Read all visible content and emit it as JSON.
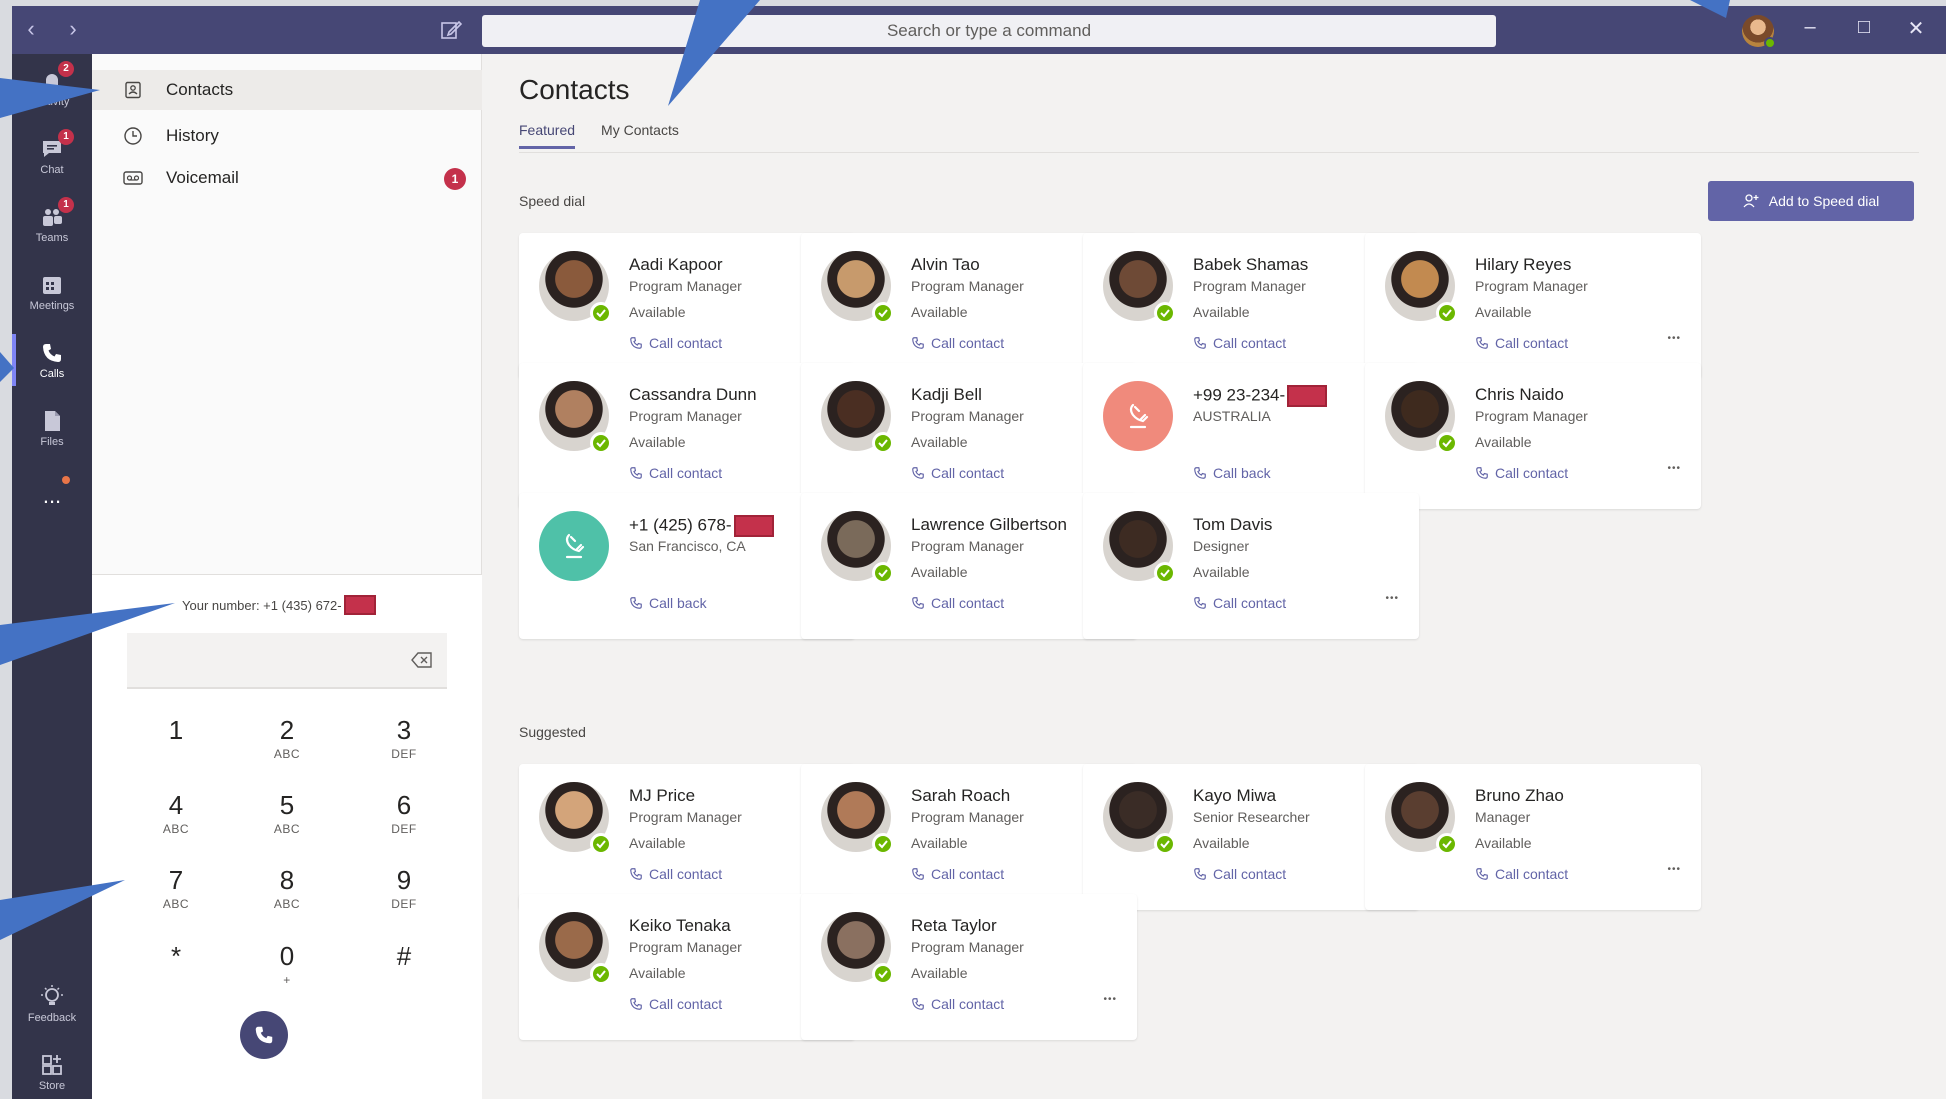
{
  "window": {
    "search_placeholder": "Search or type a command",
    "back_icon": "chevron-left-icon",
    "forward_icon": "chevron-right-icon"
  },
  "appbar": {
    "items": [
      {
        "label": "Activity",
        "icon": "bell-icon",
        "badge": "2"
      },
      {
        "label": "Chat",
        "icon": "chat-icon",
        "badge": "1"
      },
      {
        "label": "Teams",
        "icon": "teams-icon",
        "badge": "1"
      },
      {
        "label": "Meetings",
        "icon": "calendar-icon"
      },
      {
        "label": "Calls",
        "icon": "phone-icon",
        "active": true
      },
      {
        "label": "Files",
        "icon": "file-icon"
      },
      {
        "label": "...",
        "icon": "more-icon"
      },
      {
        "label": "Feedback",
        "icon": "lightbulb-icon"
      },
      {
        "label": "Store",
        "icon": "store-icon"
      }
    ]
  },
  "leftpane": {
    "items": [
      {
        "label": "Contacts",
        "icon": "contacts-icon",
        "active": true
      },
      {
        "label": "History",
        "icon": "clock-icon"
      },
      {
        "label": "Voicemail",
        "icon": "voicemail-icon",
        "badge": "1"
      }
    ],
    "your_number": "Your number: +1 (435) 672-",
    "dialpad": [
      {
        "num": "1",
        "sub": ""
      },
      {
        "num": "2",
        "sub": "ABC"
      },
      {
        "num": "3",
        "sub": "DEF"
      },
      {
        "num": "4",
        "sub": "ABC"
      },
      {
        "num": "5",
        "sub": "ABC"
      },
      {
        "num": "6",
        "sub": "DEF"
      },
      {
        "num": "7",
        "sub": "ABC"
      },
      {
        "num": "8",
        "sub": "ABC"
      },
      {
        "num": "9",
        "sub": "DEF"
      },
      {
        "num": "*",
        "sub": ""
      },
      {
        "num": "0",
        "sub": "+"
      },
      {
        "num": "#",
        "sub": ""
      }
    ]
  },
  "main": {
    "title": "Contacts",
    "tabs": [
      "Featured",
      "My Contacts"
    ],
    "speed_dial_label": "Speed dial",
    "add_speed_dial": "Add to Speed dial",
    "suggested_label": "Suggested",
    "speed_dial": [
      {
        "name": "Aadi Kapoor",
        "role": "Program Manager",
        "status": "Available",
        "action": "Call contact",
        "avatar": "#8a5a3c"
      },
      {
        "name": "Alvin Tao",
        "role": "Program Manager",
        "status": "Available",
        "action": "Call contact",
        "avatar": "#c79a6c"
      },
      {
        "name": "Babek Shamas",
        "role": "Program Manager",
        "status": "Available",
        "action": "Call contact",
        "avatar": "#6e4a36"
      },
      {
        "name": "Hilary Reyes",
        "role": "Program Manager",
        "status": "Available",
        "action": "Call contact",
        "avatar": "#c28a50"
      },
      {
        "name": "Cassandra Dunn",
        "role": "Program Manager",
        "status": "Available",
        "action": "Call contact",
        "avatar": "#b08060"
      },
      {
        "name": "Kadji Bell",
        "role": "Program Manager",
        "status": "Available",
        "action": "Call contact",
        "avatar": "#4a2e22"
      },
      {
        "name": "+99 23-234-",
        "role": "AUSTRALIA",
        "status": "",
        "action": "Call back",
        "avatar": "#f08a7c",
        "phone": true,
        "redacted": true
      },
      {
        "name": "Chris Naido",
        "role": "Program Manager",
        "status": "Available",
        "action": "Call contact",
        "avatar": "#3e2a1e"
      },
      {
        "name": "+1 (425) 678-",
        "role": "San Francisco, CA",
        "status": "",
        "action": "Call back",
        "avatar": "#4fc1a8",
        "phone": true,
        "redacted": true
      },
      {
        "name": "Lawrence Gilbertson",
        "role": "Program Manager",
        "status": "Available",
        "action": "Call contact",
        "avatar": "#7a6a5a"
      },
      {
        "name": "Tom Davis",
        "role": "Designer",
        "status": "Available",
        "action": "Call contact",
        "avatar": "#3d2b22"
      }
    ],
    "suggested": [
      {
        "name": "MJ Price",
        "role": "Program Manager",
        "status": "Available",
        "action": "Call contact",
        "avatar": "#d3a47a"
      },
      {
        "name": "Sarah Roach",
        "role": "Program Manager",
        "status": "Available",
        "action": "Call contact",
        "avatar": "#b07a58"
      },
      {
        "name": "Kayo Miwa",
        "role": "Senior Researcher",
        "status": "Available",
        "action": "Call contact",
        "avatar": "#3a2c26"
      },
      {
        "name": "Bruno Zhao",
        "role": "Manager",
        "status": "Available",
        "action": "Call contact",
        "avatar": "#5a3e30"
      },
      {
        "name": "Keiko Tenaka",
        "role": "Program Manager",
        "status": "Available",
        "action": "Call contact",
        "avatar": "#9a6a4a"
      },
      {
        "name": "Reta Taylor",
        "role": "Program Manager",
        "status": "Available",
        "action": "Call contact",
        "avatar": "#8a7060"
      }
    ]
  },
  "colors": {
    "titlebar": "#464775",
    "accent": "#6264a7",
    "appbar": "#33344a",
    "available": "#6bb700",
    "badge": "#c4314b",
    "callout": "#4472c4"
  }
}
